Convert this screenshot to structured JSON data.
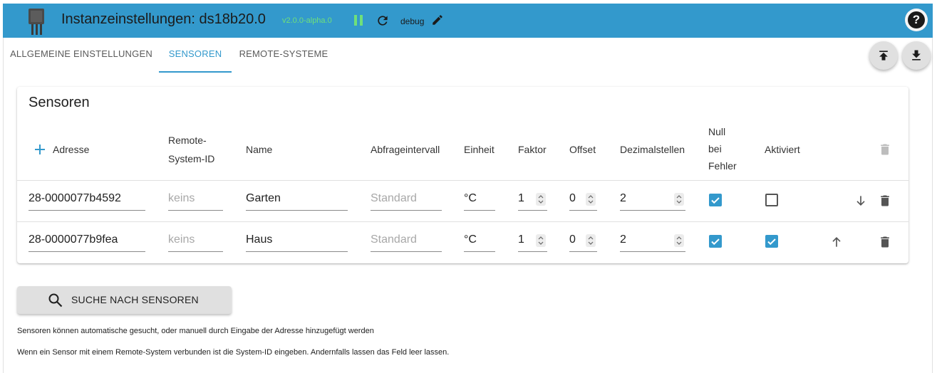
{
  "header": {
    "title": "Instanzeinstellungen: ds18b20.0",
    "version": "v2.0.0-alpha.0",
    "log_level": "debug",
    "help_label": "?"
  },
  "tabs": [
    {
      "label": "ALLGEMEINE EINSTELLUNGEN",
      "active": false
    },
    {
      "label": "SENSOREN",
      "active": true
    },
    {
      "label": "REMOTE-SYSTEME",
      "active": false
    }
  ],
  "card": {
    "title": "Sensoren",
    "columns": {
      "address": "Adresse",
      "remote_line1": "Remote-",
      "remote_line2": "System-ID",
      "name": "Name",
      "interval": "Abfrageintervall",
      "unit": "Einheit",
      "factor": "Faktor",
      "offset": "Offset",
      "decimals": "Dezimalstellen",
      "null_line1": "Null",
      "null_line2": "bei",
      "null_line3": "Fehler",
      "enabled": "Aktiviert"
    },
    "rows": [
      {
        "address": "28-0000077b4592",
        "remote_placeholder": "keins",
        "name": "Garten",
        "interval_placeholder": "Standard",
        "unit": "°C",
        "factor": "1",
        "offset": "0",
        "decimals": "2",
        "null_on_error": true,
        "enabled": false
      },
      {
        "address": "28-0000077b9fea",
        "remote_placeholder": "keins",
        "name": "Haus",
        "interval_placeholder": "Standard",
        "unit": "°C",
        "factor": "1",
        "offset": "0",
        "decimals": "2",
        "null_on_error": true,
        "enabled": true
      }
    ]
  },
  "search_button": {
    "label": "SUCHE NACH SENSOREN"
  },
  "notes": {
    "line1": "Sensoren können automatische gesucht, oder manuell durch Eingabe der Adresse hinzugefügt werden",
    "line2": "Wenn ein Sensor mit einem Remote-System verbunden ist die System-ID eingeben. Andernfalls lassen das Feld leer lassen."
  },
  "colors": {
    "header": "#3399cc",
    "accent": "#3399cc",
    "version": "#6fe07a"
  },
  "icons": [
    "sensor-logo-icon",
    "pause-icon",
    "reload-icon",
    "edit-icon",
    "help-icon",
    "upload-icon",
    "download-icon",
    "add-icon",
    "delete-icon",
    "arrow-down-icon",
    "arrow-up-icon",
    "search-icon",
    "check-icon"
  ]
}
